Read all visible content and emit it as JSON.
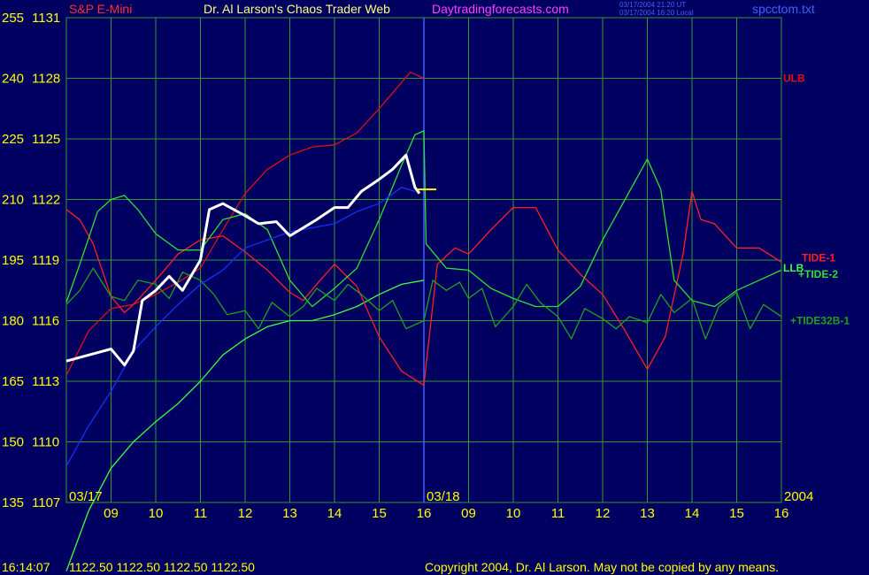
{
  "header": {
    "symbol": "S&P E-Mini",
    "title": "Dr. Al Larson's Chaos Trader Web",
    "site": "Daytradingforecasts.com",
    "timestamp_ut": "03/17/2004 21:20 UT",
    "timestamp_local": "03/17/2004 16:20 Local",
    "file": "spcctom.txt"
  },
  "footer": {
    "time": "16:14:07",
    "quote": "1122.50 1122.50 1122.50 1122.50",
    "copyright": "Copyright 2004, Dr. Al Larson. May not be copied by any means."
  },
  "colors": {
    "background": "#000060",
    "grid": "#2f9a2f",
    "symbol": "#ff3030",
    "title": "#ffff80",
    "site": "#ff40ff",
    "axis_text": "#ffff00",
    "ulb": "#e01010",
    "llb": "#40ff40",
    "tide1": "#ff2020",
    "tide2": "#30e030",
    "tide32b1": "#20a020",
    "price": "#ffffff",
    "moving_avg": "#1530ff",
    "divider": "#4060ff"
  },
  "chart_data": {
    "type": "line",
    "title": "S&P E-Mini",
    "ylim": [
      1107,
      1131
    ],
    "ylim_left": [
      135,
      255
    ],
    "yticks": [
      {
        "left": "255",
        "right": "1131",
        "value": 1131
      },
      {
        "left": "240",
        "right": "1128",
        "value": 1128
      },
      {
        "left": "225",
        "right": "1125",
        "value": 1125
      },
      {
        "left": "210",
        "right": "1122",
        "value": 1122
      },
      {
        "left": "195",
        "right": "1119",
        "value": 1119
      },
      {
        "left": "180",
        "right": "1116",
        "value": 1116
      },
      {
        "left": "165",
        "right": "1113",
        "value": 1113
      },
      {
        "left": "150",
        "right": "1110",
        "value": 1110
      },
      {
        "left": "135",
        "right": "1107",
        "value": 1107
      }
    ],
    "xlim": [
      8,
      24
    ],
    "xticks": [
      {
        "label": "09",
        "x": 9
      },
      {
        "label": "10",
        "x": 10
      },
      {
        "label": "11",
        "x": 11
      },
      {
        "label": "12",
        "x": 12
      },
      {
        "label": "13",
        "x": 13
      },
      {
        "label": "14",
        "x": 14
      },
      {
        "label": "15",
        "x": 15
      },
      {
        "label": "16",
        "x": 16
      },
      {
        "label": "09",
        "x": 17
      },
      {
        "label": "10",
        "x": 18
      },
      {
        "label": "11",
        "x": 19
      },
      {
        "label": "12",
        "x": 20
      },
      {
        "label": "13",
        "x": 21
      },
      {
        "label": "14",
        "x": 22
      },
      {
        "label": "15",
        "x": 23
      },
      {
        "label": "16",
        "x": 24
      }
    ],
    "date_labels": [
      {
        "label": "03/17",
        "x": 8
      },
      {
        "label": "03/18",
        "x": 16
      },
      {
        "label": "2004",
        "x": 24
      }
    ],
    "day_divider_x": 16,
    "grid": true,
    "series": [
      {
        "name": "ULB",
        "key": "ulb",
        "points": [
          [
            8,
            1113.3
          ],
          [
            8.5,
            1115.5
          ],
          [
            9,
            1116.6
          ],
          [
            9.5,
            1116.8
          ],
          [
            10,
            1117.3
          ],
          [
            10.5,
            1117.9
          ],
          [
            11,
            1118.6
          ],
          [
            11.5,
            1120.5
          ],
          [
            12,
            1122.3
          ],
          [
            12.5,
            1123.5
          ],
          [
            13,
            1124.2
          ],
          [
            13.5,
            1124.6
          ],
          [
            14,
            1124.7
          ],
          [
            14.5,
            1125.3
          ],
          [
            15,
            1126.5
          ],
          [
            15.5,
            1127.8
          ],
          [
            15.7,
            1128.3
          ],
          [
            16,
            1128.0
          ]
        ]
      },
      {
        "name": "LLB",
        "key": "llb",
        "points": [
          [
            8,
            1103.6
          ],
          [
            8.5,
            1106.6
          ],
          [
            9,
            1108.7
          ],
          [
            9.5,
            1110.0
          ],
          [
            10,
            1111.0
          ],
          [
            10.5,
            1111.9
          ],
          [
            11,
            1113.0
          ],
          [
            11.5,
            1114.3
          ],
          [
            12,
            1115.1
          ],
          [
            12.5,
            1115.7
          ],
          [
            13,
            1116.0
          ],
          [
            13.5,
            1116.0
          ],
          [
            14,
            1116.3
          ],
          [
            14.5,
            1116.7
          ],
          [
            15,
            1117.3
          ],
          [
            15.5,
            1117.8
          ],
          [
            16,
            1118.0
          ]
        ]
      },
      {
        "name": "TIDE-1",
        "key": "tide1",
        "points": [
          [
            8,
            1121.5
          ],
          [
            8.3,
            1121.0
          ],
          [
            8.6,
            1119.8
          ],
          [
            9,
            1117.2
          ],
          [
            9.3,
            1116.4
          ],
          [
            9.5,
            1116.8
          ],
          [
            10,
            1118.0
          ],
          [
            10.5,
            1119.3
          ],
          [
            11,
            1120.0
          ],
          [
            11.5,
            1120.2
          ],
          [
            12,
            1119.4
          ],
          [
            12.5,
            1118.5
          ],
          [
            13,
            1117.4
          ],
          [
            13.3,
            1117.0
          ],
          [
            13.6,
            1117.8
          ],
          [
            14,
            1118.8
          ],
          [
            14.5,
            1117.7
          ],
          [
            15,
            1115.2
          ],
          [
            15.5,
            1113.5
          ],
          [
            16,
            1112.8
          ],
          [
            16.3,
            1118.8
          ],
          [
            16.7,
            1119.6
          ],
          [
            17,
            1119.3
          ],
          [
            17.5,
            1120.5
          ],
          [
            18,
            1121.6
          ],
          [
            18.5,
            1121.6
          ],
          [
            19,
            1119.5
          ],
          [
            19.5,
            1118.3
          ],
          [
            20,
            1117.3
          ],
          [
            20.5,
            1115.5
          ],
          [
            21,
            1113.6
          ],
          [
            21.4,
            1115.2
          ],
          [
            21.8,
            1119.3
          ],
          [
            22,
            1122.4
          ],
          [
            22.2,
            1121.0
          ],
          [
            22.5,
            1120.8
          ],
          [
            23,
            1119.6
          ],
          [
            23.5,
            1119.6
          ],
          [
            24,
            1118.9
          ]
        ]
      },
      {
        "name": "TIDE-2",
        "key": "tide2",
        "points": [
          [
            8,
            1116.9
          ],
          [
            8.3,
            1118.8
          ],
          [
            8.7,
            1121.4
          ],
          [
            9,
            1122.0
          ],
          [
            9.3,
            1122.2
          ],
          [
            9.6,
            1121.5
          ],
          [
            10,
            1120.3
          ],
          [
            10.5,
            1119.5
          ],
          [
            11,
            1119.5
          ],
          [
            11.5,
            1121.0
          ],
          [
            12,
            1121.3
          ],
          [
            12.5,
            1120.5
          ],
          [
            13,
            1118.0
          ],
          [
            13.5,
            1116.7
          ],
          [
            14,
            1117.6
          ],
          [
            14.5,
            1118.6
          ],
          [
            15,
            1121.0
          ],
          [
            15.5,
            1123.7
          ],
          [
            15.8,
            1125.2
          ],
          [
            16,
            1125.4
          ],
          [
            16.05,
            1119.8
          ],
          [
            16.5,
            1118.6
          ],
          [
            17,
            1118.5
          ],
          [
            17.5,
            1117.6
          ],
          [
            18,
            1117.1
          ],
          [
            18.5,
            1116.7
          ],
          [
            19,
            1116.7
          ],
          [
            19.5,
            1117.7
          ],
          [
            20,
            1120.0
          ],
          [
            20.5,
            1122.0
          ],
          [
            21,
            1124.0
          ],
          [
            21.3,
            1122.5
          ],
          [
            21.6,
            1118.0
          ],
          [
            22,
            1117.0
          ],
          [
            22.5,
            1116.7
          ],
          [
            23,
            1117.5
          ],
          [
            23.5,
            1118.0
          ],
          [
            24,
            1118.5
          ]
        ]
      },
      {
        "name": "TIDE32B-1",
        "key": "tide32b1",
        "points": [
          [
            8,
            1116.8
          ],
          [
            8.3,
            1117.5
          ],
          [
            8.6,
            1118.6
          ],
          [
            9,
            1117.2
          ],
          [
            9.3,
            1117.0
          ],
          [
            9.6,
            1118.0
          ],
          [
            10,
            1117.8
          ],
          [
            10.3,
            1117.1
          ],
          [
            10.6,
            1118.4
          ],
          [
            11,
            1118.0
          ],
          [
            11.3,
            1117.3
          ],
          [
            11.6,
            1116.3
          ],
          [
            12,
            1116.5
          ],
          [
            12.3,
            1115.6
          ],
          [
            12.6,
            1116.9
          ],
          [
            13,
            1116.2
          ],
          [
            13.3,
            1116.7
          ],
          [
            13.6,
            1117.6
          ],
          [
            14,
            1117.0
          ],
          [
            14.3,
            1117.8
          ],
          [
            14.6,
            1117.3
          ],
          [
            15,
            1116.5
          ],
          [
            15.3,
            1117.0
          ],
          [
            15.6,
            1115.6
          ],
          [
            16,
            1116.0
          ],
          [
            16.2,
            1118.0
          ],
          [
            16.5,
            1117.5
          ],
          [
            16.8,
            1117.9
          ],
          [
            17,
            1117.1
          ],
          [
            17.3,
            1117.6
          ],
          [
            17.6,
            1115.7
          ],
          [
            18,
            1116.7
          ],
          [
            18.3,
            1117.8
          ],
          [
            18.6,
            1116.9
          ],
          [
            19,
            1116.2
          ],
          [
            19.3,
            1115.1
          ],
          [
            19.6,
            1116.6
          ],
          [
            20,
            1116.1
          ],
          [
            20.3,
            1115.6
          ],
          [
            20.6,
            1116.2
          ],
          [
            21,
            1115.9
          ],
          [
            21.3,
            1117.3
          ],
          [
            21.6,
            1116.4
          ],
          [
            22,
            1117.1
          ],
          [
            22.3,
            1115.1
          ],
          [
            22.6,
            1116.7
          ],
          [
            23,
            1117.4
          ],
          [
            23.3,
            1115.6
          ],
          [
            23.6,
            1116.8
          ],
          [
            24,
            1116.2
          ]
        ]
      },
      {
        "name": "Moving Average",
        "key": "moving_avg",
        "points": [
          [
            8,
            1108.8
          ],
          [
            8.5,
            1110.8
          ],
          [
            9,
            1112.5
          ],
          [
            9.5,
            1114.5
          ],
          [
            10,
            1115.7
          ],
          [
            10.5,
            1116.8
          ],
          [
            11,
            1117.8
          ],
          [
            11.5,
            1118.5
          ],
          [
            12,
            1119.6
          ],
          [
            12.5,
            1120.0
          ],
          [
            13,
            1120.4
          ],
          [
            13.5,
            1120.6
          ],
          [
            14,
            1120.8
          ],
          [
            14.5,
            1121.4
          ],
          [
            15,
            1121.8
          ],
          [
            15.5,
            1122.6
          ],
          [
            15.8,
            1122.4
          ]
        ]
      },
      {
        "name": "Price",
        "key": "price",
        "points": [
          [
            8,
            1114.0
          ],
          [
            8.5,
            1114.3
          ],
          [
            9,
            1114.6
          ],
          [
            9.3,
            1113.8
          ],
          [
            9.5,
            1114.5
          ],
          [
            9.7,
            1117.0
          ],
          [
            10,
            1117.5
          ],
          [
            10.3,
            1118.2
          ],
          [
            10.6,
            1117.5
          ],
          [
            11,
            1119.0
          ],
          [
            11.2,
            1121.5
          ],
          [
            11.5,
            1121.8
          ],
          [
            12,
            1121.2
          ],
          [
            12.3,
            1120.8
          ],
          [
            12.7,
            1120.9
          ],
          [
            13,
            1120.2
          ],
          [
            13.3,
            1120.6
          ],
          [
            13.6,
            1121.0
          ],
          [
            14,
            1121.6
          ],
          [
            14.3,
            1121.6
          ],
          [
            14.6,
            1122.4
          ],
          [
            15,
            1123.0
          ],
          [
            15.3,
            1123.5
          ],
          [
            15.6,
            1124.2
          ],
          [
            15.8,
            1122.6
          ],
          [
            15.9,
            1122.3
          ]
        ]
      }
    ],
    "last_price_marker": {
      "x": 16,
      "y": 1122.5
    },
    "annotations": [
      {
        "label": "ULB",
        "key": "ulb"
      },
      {
        "label": "LLB",
        "key": "llb"
      },
      {
        "label": "TIDE-1",
        "key": "tide1"
      },
      {
        "label": "+TIDE-2",
        "key": "tide2"
      },
      {
        "label": "+TIDE32B-1",
        "key": "tide32b1"
      }
    ]
  }
}
